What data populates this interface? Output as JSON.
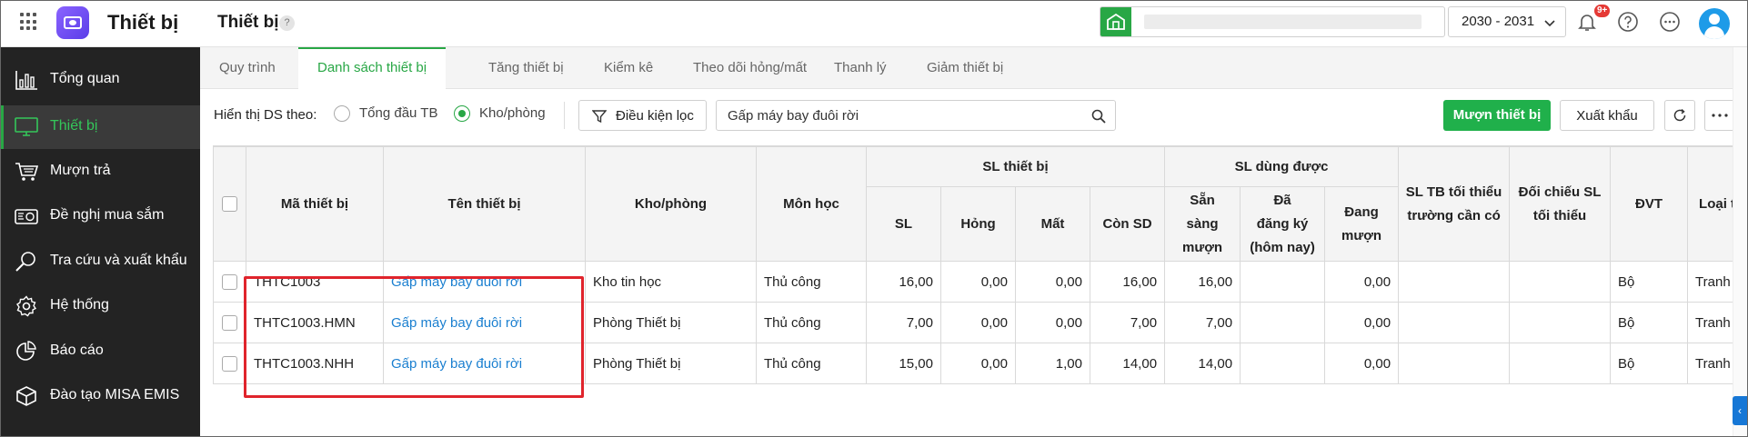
{
  "header": {
    "app_name": "Thiết bị",
    "page_title": "Thiết bị",
    "help_mark": "?",
    "school_year": "2030 - 2031",
    "notification_badge": "9+"
  },
  "sidebar": {
    "items": [
      {
        "label": "Tổng quan",
        "icon": "chart-bars-icon",
        "active": false
      },
      {
        "label": "Thiết bị",
        "icon": "monitor-icon",
        "active": true
      },
      {
        "label": "Mượn trả",
        "icon": "cart-icon",
        "active": false
      },
      {
        "label": "Đề nghị mua sắm",
        "icon": "purchase-request-icon",
        "active": false
      },
      {
        "label": "Tra cứu và xuất khẩu",
        "icon": "search-icon",
        "active": false
      },
      {
        "label": "Hệ thống",
        "icon": "gear-icon",
        "active": false
      },
      {
        "label": "Báo cáo",
        "icon": "pie-chart-icon",
        "active": false
      },
      {
        "label": "Đào tạo MISA EMIS",
        "icon": "cube-icon",
        "active": false
      }
    ]
  },
  "tabs": [
    {
      "label": "Quy trình",
      "active": false
    },
    {
      "label": "Danh sách thiết bị",
      "active": true
    },
    {
      "label": "Tăng thiết bị",
      "active": false
    },
    {
      "label": "Kiểm kê",
      "active": false
    },
    {
      "label": "Theo dõi hỏng/mất",
      "active": false
    },
    {
      "label": "Thanh lý",
      "active": false
    },
    {
      "label": "Giảm thiết bị",
      "active": false
    }
  ],
  "filter": {
    "label": "Hiển thị DS theo:",
    "options": [
      {
        "label": "Tổng đầu TB",
        "checked": false
      },
      {
        "label": "Kho/phòng",
        "checked": true
      }
    ],
    "condition_button": "Điều kiện lọc",
    "search_value": "Gấp máy bay đuôi rời",
    "borrow_button": "Mượn thiết bị",
    "export_button": "Xuất khẩu"
  },
  "table": {
    "headers": {
      "code": "Mã thiết bị",
      "name": "Tên thiết bị",
      "room": "Kho/phòng",
      "subject": "Môn học",
      "sl_group": "SL thiết bị",
      "sl": "SL",
      "broken": "Hỏng",
      "lost": "Mất",
      "remaining": "Còn SD",
      "usable_group": "SL dùng được",
      "ready_line1": "Sẵn",
      "ready_line2": "sàng",
      "ready_line3": "mượn",
      "registered_line1": "Đã",
      "registered_line2": "đăng ký",
      "registered_line3": "(hôm nay)",
      "borrowing_line1": "Đang",
      "borrowing_line2": "mượn",
      "min_line1": "SL TB tối thiểu",
      "min_line2": "trường cần có",
      "compare_line1": "Đối chiếu SL",
      "compare_line2": "tối thiểu",
      "unit": "ĐVT",
      "type": "Loại t"
    },
    "rows": [
      {
        "code": "THTC1003",
        "name": "Gấp máy bay đuôi rời",
        "room": "Kho tin học",
        "subject": "Thủ công",
        "sl": "16,00",
        "broken": "0,00",
        "lost": "0,00",
        "remaining": "16,00",
        "ready": "16,00",
        "registered": "",
        "borrowing": "0,00",
        "min": "",
        "compare": "",
        "unit": "Bộ",
        "type": "Tranh ả"
      },
      {
        "code": "THTC1003.HMN",
        "name": "Gấp máy bay đuôi rời",
        "room": "Phòng Thiết bị",
        "subject": "Thủ công",
        "sl": "7,00",
        "broken": "0,00",
        "lost": "0,00",
        "remaining": "7,00",
        "ready": "7,00",
        "registered": "",
        "borrowing": "0,00",
        "min": "",
        "compare": "",
        "unit": "Bộ",
        "type": "Tranh ả"
      },
      {
        "code": "THTC1003.NHH",
        "name": "Gấp máy bay đuôi rời",
        "room": "Phòng Thiết bị",
        "subject": "Thủ công",
        "sl": "15,00",
        "broken": "0,00",
        "lost": "1,00",
        "remaining": "14,00",
        "ready": "14,00",
        "registered": "",
        "borrowing": "0,00",
        "min": "",
        "compare": "",
        "unit": "Bộ",
        "type": "Tranh ả"
      }
    ]
  },
  "side_tab_glyph": "‹",
  "colors": {
    "accent": "#28a745",
    "primary_button": "#20b04b",
    "link": "#1a7fd0",
    "highlight": "#e0242c",
    "sidebar": "#232323"
  }
}
